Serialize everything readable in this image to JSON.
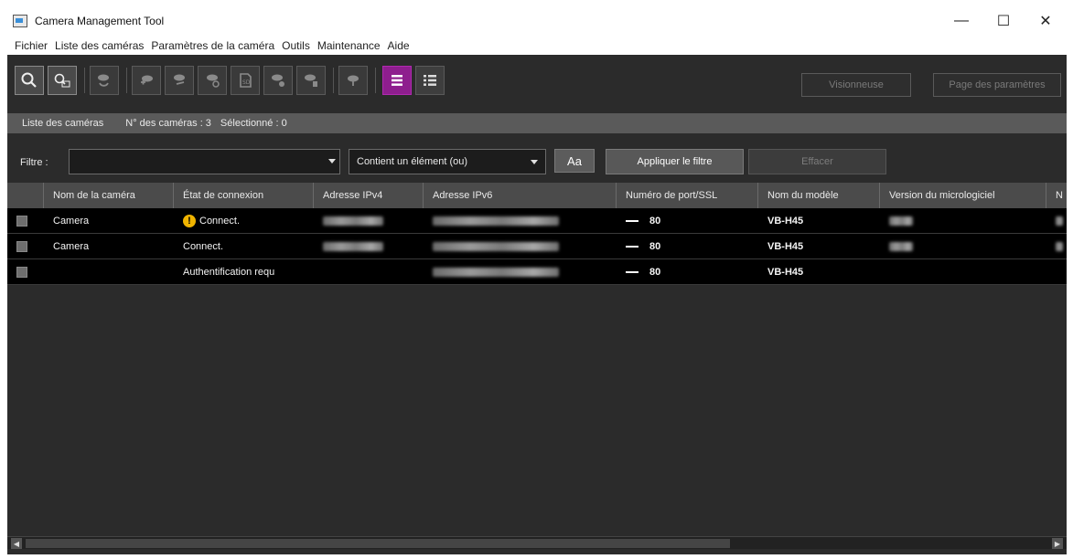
{
  "window": {
    "title": "Camera Management Tool",
    "controls": [
      "—",
      "☐",
      "✕"
    ]
  },
  "menu": [
    "Fichier",
    "Liste des caméras",
    "Paramètres de la caméra",
    "Outils",
    "Maintenance",
    "Aide"
  ],
  "toolbar": {
    "viewer_label": "Visionneuse",
    "settings_page_label": "Page des paramètres"
  },
  "listbar": {
    "title": "Liste des caméras",
    "count": "N° des caméras : 3",
    "selected": "Sélectionné : 0"
  },
  "filter": {
    "label": "Filtre :",
    "value": "",
    "mode": "Contient un élément (ou)",
    "case_label": "Aa",
    "apply_label": "Appliquer le filtre",
    "clear_label": "Effacer"
  },
  "table": {
    "columns": [
      "Nom de la caméra",
      "État de connexion",
      "Adresse IPv4",
      "Adresse IPv6",
      "Numéro de port/SSL",
      "Nom du modèle",
      "Version du micrologiciel",
      "N"
    ],
    "rows": [
      {
        "name": "Camera",
        "status": "Connect.",
        "status_icon": "warning-icon",
        "port": "80",
        "model": "VB-H45"
      },
      {
        "name": "Camera",
        "status": "Connect.",
        "status_icon": "",
        "port": "80",
        "model": "VB-H45"
      },
      {
        "name": "",
        "status": "Authentification requ",
        "status_icon": "",
        "port": "80",
        "model": "VB-H45"
      }
    ]
  },
  "colors": {
    "accent": "#8e1e8e",
    "background": "#2b2b2b",
    "row_bg": "#000000",
    "warning": "#f0b400"
  }
}
